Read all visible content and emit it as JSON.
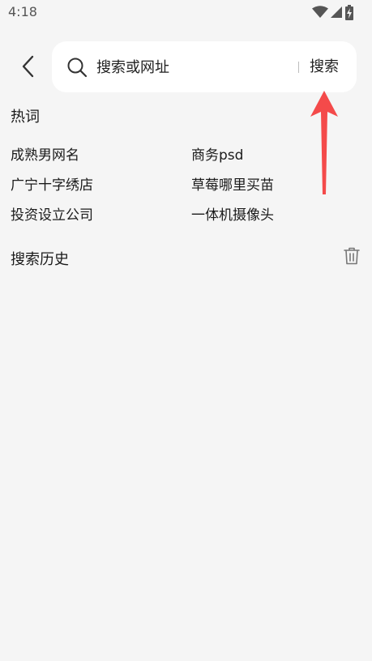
{
  "status_bar": {
    "time": "4:18",
    "icons": [
      "wifi-icon",
      "signal-icon",
      "battery-charging-icon"
    ]
  },
  "header": {
    "back_icon": "chevron-left-icon",
    "search": {
      "icon": "search-icon",
      "placeholder": "搜索或网址",
      "value": "",
      "button_label": "搜索"
    }
  },
  "hot_words": {
    "title": "热词",
    "items": [
      "成熟男网名",
      "商务psd",
      "广宁十字绣店",
      "草莓哪里买苗",
      "投资设立公司",
      "一体机摄像头"
    ]
  },
  "search_history": {
    "title": "搜索历史",
    "clear_icon": "trash-icon",
    "items": []
  },
  "colors": {
    "background": "#f5f5f5",
    "search_box": "#ffffff",
    "annotation_arrow": "#f44a4a"
  }
}
